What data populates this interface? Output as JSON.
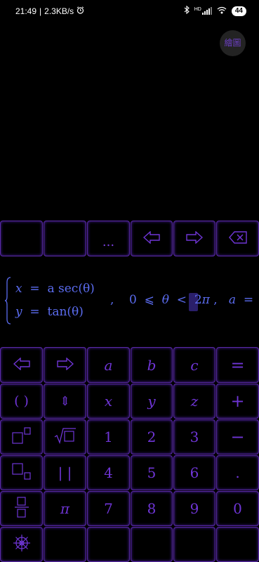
{
  "status": {
    "time": "21:49",
    "speed": "2.3KB/s",
    "alarm_icon": "alarm-icon",
    "bluetooth_icon": "bluetooth-icon",
    "signal_label": "HD",
    "wifi_icon": "wifi-icon",
    "battery": "44"
  },
  "draw_button": {
    "label": "繪圖"
  },
  "top_row": {
    "ellipsis": "...",
    "left_icon": "arrow-left-icon",
    "right_icon": "arrow-right-icon",
    "delete_icon": "backspace-icon"
  },
  "formula": {
    "line1_x": "x",
    "line1_eq": "=",
    "line1_rhs": "a sec(θ)",
    "line2_y": "y",
    "line2_eq": "=",
    "line2_rhs": "tan(θ)",
    "comma1": ",",
    "zero": "0",
    "leq": "⩽",
    "theta": "θ",
    "lt": "<",
    "two": "2",
    "pi": "π",
    "comma2": ",",
    "a": "a",
    "eq": "="
  },
  "keypad": {
    "row1": [
      "⇦",
      "⇨",
      "a",
      "b",
      "c",
      "="
    ],
    "row2": [
      "( )",
      "⇕",
      "x",
      "y",
      "z",
      "+"
    ],
    "row3": [
      "□²",
      "√□",
      "1",
      "2",
      "3",
      "−"
    ],
    "row4": [
      "□₂",
      "| |",
      "4",
      "5",
      "6",
      "."
    ],
    "row5": [
      "frac",
      "π",
      "7",
      "8",
      "9",
      "0"
    ],
    "row6_icon": "settings-wheel-icon"
  }
}
